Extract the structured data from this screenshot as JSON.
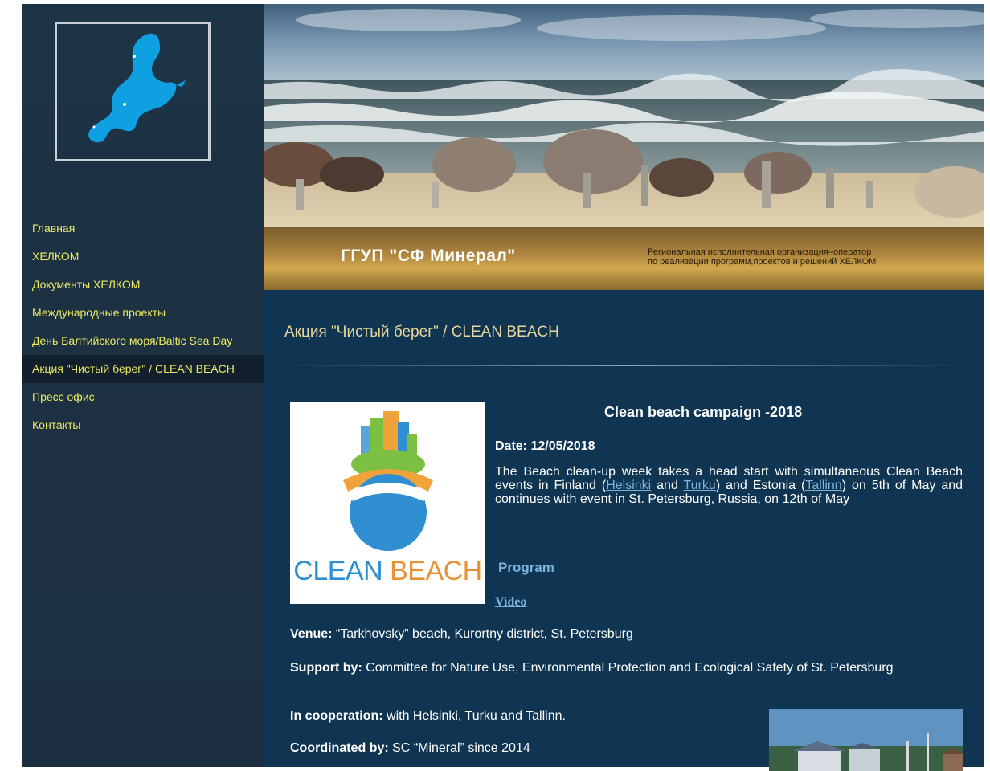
{
  "sidebar": {
    "nav": [
      {
        "label": "Главная"
      },
      {
        "label": "ХЕЛКОМ"
      },
      {
        "label": "Документы ХЕЛКОМ"
      },
      {
        "label": "Международные проекты"
      },
      {
        "label": "День Балтийского моря/Baltic Sea Day"
      },
      {
        "label": "Акция \"Чистый берег\" / CLEAN BEACH",
        "active": true
      },
      {
        "label": "Пресс офис"
      },
      {
        "label": "Контакты"
      }
    ]
  },
  "banner": {
    "title": "ГГУП \"СФ Минерал\"",
    "subtitle": "Региональная исполнительная организация–оператор\nпо реализации программ,проектов и решений ХЕЛКОМ"
  },
  "page": {
    "heading": "Акция \"Чистый берег\" / CLEAN BEACH"
  },
  "article": {
    "logo_text_clean": "CLEAN",
    "logo_text_beach": "BEACH",
    "title": "Clean beach campaign -2018",
    "date": "Date: 12/05/2018",
    "para_1": "The Beach clean-up week takes a head start with simultaneous Clean Beach events in Finland (",
    "link_helsinki": "Helsinki",
    "para_2": " and ",
    "link_turku": "Turku",
    "para_3": ") and Estonia (",
    "link_tallinn": "Tallinn",
    "para_4": ") on 5th of May and continues with event in St. Petersburg, Russia, on 12th of May",
    "program_link": "Program",
    "video_link": "Video",
    "venue_label": "Venue:",
    "venue_value": " “Tarkhovsky” beach, Kurortny district, St. Petersburg",
    "support_label": "Support by:",
    "support_value": " Committee for Nature Use, Environmental Protection and Ecological Safety of St. Petersburg",
    "coop_label": "In cooperation:",
    "coop_value": "  with Helsinki, Turku and Tallinn.",
    "coord_label": "Coordinated by:",
    "coord_value": " SC “Mineral” since 2014"
  },
  "colors": {
    "sidebar_bg": "#1c3142",
    "nav_text": "#ecea63",
    "main_bg": "#0f3552",
    "link": "#7ab3dc",
    "heading": "#e8d59a"
  }
}
